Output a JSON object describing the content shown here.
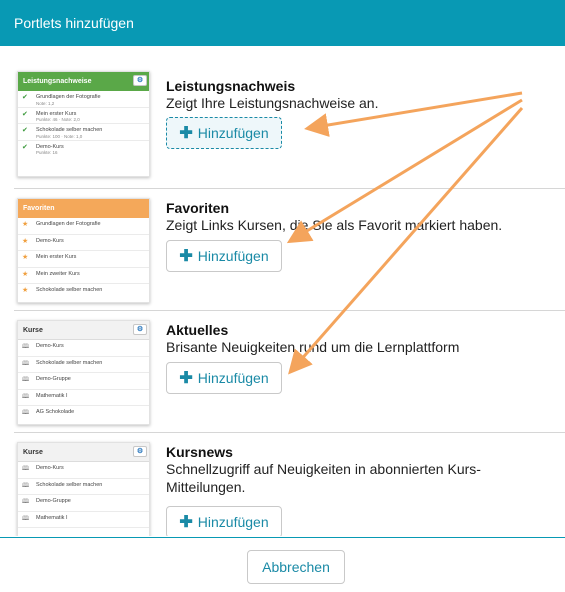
{
  "dialog": {
    "title": "Portlets hinzufügen",
    "cancel_label": "Abbrechen"
  },
  "colors": {
    "header": "#0899b4",
    "accent": "#1a8aa6",
    "annotation_arrow": "#f4a45c",
    "thumb_green": "#5aa848",
    "thumb_orange": "#f4a85a"
  },
  "portlets": [
    {
      "title": "Leistungsnachweis",
      "description": "Zeigt Ihre Leistungsnachweise an.",
      "add_label": "Hinzufügen",
      "preview": {
        "header": "Leistungsnachweise",
        "header_style": "green",
        "icon": "check-icon",
        "items": [
          {
            "label": "Grundlagen der Fotografie",
            "sub": "Note: 1,2"
          },
          {
            "label": "Mein erster Kurs",
            "sub": "Punkte: 46 · Note: 2,0"
          },
          {
            "label": "Schokolade selber machen",
            "sub": "Punkte: 100 · Note: 1,0"
          },
          {
            "label": "Demo-Kurs",
            "sub": "Punkte: 16"
          }
        ]
      }
    },
    {
      "title": "Favoriten",
      "description": "Zeigt Links Kursen, die Sie als Favorit markiert haben.",
      "add_label": "Hinzufügen",
      "preview": {
        "header": "Favoriten",
        "header_style": "orange",
        "icon": "star-icon",
        "items": [
          {
            "label": "Grundlagen der Fotografie"
          },
          {
            "label": "Demo-Kurs"
          },
          {
            "label": "Mein erster Kurs"
          },
          {
            "label": "Mein zweiter Kurs"
          },
          {
            "label": "Schokolade selber machen"
          }
        ]
      }
    },
    {
      "title": "Aktuelles",
      "description": "Brisante Neuigkeiten rund um die Lernplattform",
      "add_label": "Hinzufügen",
      "preview": {
        "header": "Kurse",
        "header_style": "gray",
        "icon": "book-icon",
        "items": [
          {
            "label": "Demo-Kurs"
          },
          {
            "label": "Schokolade selber machen"
          },
          {
            "label": "Demo-Gruppe"
          },
          {
            "label": "Mathematik I"
          },
          {
            "label": "AG Schokolade"
          }
        ]
      }
    },
    {
      "title": "Kursnews",
      "description": "Schnellzugriff auf Neuigkeiten in abonnierten Kurs-Mitteilungen.",
      "add_label": "Hinzufügen",
      "preview": {
        "header": "Kurse",
        "header_style": "gray",
        "icon": "book-icon",
        "items": [
          {
            "label": "Demo-Kurs"
          },
          {
            "label": "Schokolade selber machen"
          },
          {
            "label": "Demo-Gruppe"
          },
          {
            "label": "Mathematik I"
          }
        ]
      }
    }
  ]
}
